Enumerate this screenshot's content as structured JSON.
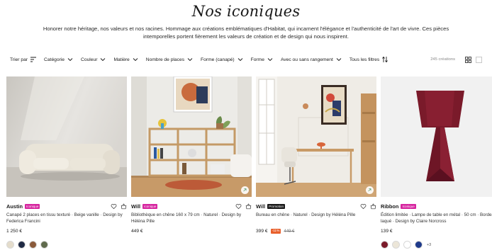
{
  "header": {
    "title": "Nos iconiques",
    "intro_line1": "Honorer notre héritage, nos valeurs et nos racines. Hommage aux créations emblématiques d'Habitat, qui incarnent l'élégance et l'authenticité de l'art de vivre. Ces pièces",
    "intro_line2": "intemporelles portent fièrement les valeurs de création et de design qui nous inspirent."
  },
  "filters": {
    "sort_label": "Trier par",
    "items": [
      "Catégorie",
      "Couleur",
      "Matière",
      "Nombre de places",
      "Forme (canapé)",
      "Forme",
      "Avec ou sans rangement"
    ],
    "all_filters_label": "Tous les filtres",
    "count_label": "245 créations"
  },
  "icons": {
    "sort": "sort-lines-icon",
    "all_filters": "sliders-icon",
    "grid": "grid-view-icon",
    "list": "list-view-icon",
    "wishlist": "heart-icon",
    "cart": "basket-icon",
    "ar": "3d-view-icon"
  },
  "products": [
    {
      "name": "Austin",
      "tag": "Iconique",
      "desc": "Canapé 2 places en tissu texturé · Beige vanille · Design by Federica Francini",
      "price": "1 250 €",
      "swatches": [
        "#e4dccb",
        "#1f2a44",
        "#8a5a3a",
        "#5f6a4c"
      ],
      "more": ""
    },
    {
      "name": "Will",
      "tag": "Iconique",
      "desc": "Bibliothèque en chêne 160 x 79 cm · Naturel · Design by Héléna Pille",
      "price": "449 €",
      "swatches": [],
      "more": ""
    },
    {
      "name": "Will",
      "tag": "Promotion",
      "desc": "Bureau en chêne · Naturel · Design by Héléna Pille",
      "price": "399 €",
      "discount": "-11%",
      "old_price": "449 €",
      "swatches": [],
      "more": ""
    },
    {
      "name": "Ribbon",
      "tag": "Iconique",
      "desc": "Édition limitée · Lampe de table en métal · 50 cm · Bordeaux laqué · Design by Claire Norcross",
      "price": "139 €",
      "swatches": [
        "#7a1a2a",
        "#ece6d8",
        "#ffffff",
        "#1e3a8a"
      ],
      "more": "+3"
    }
  ],
  "colors": {
    "accent_tag": "#d6249f",
    "promo_tag": "#1a1a1a",
    "discount": "#e8602c"
  }
}
